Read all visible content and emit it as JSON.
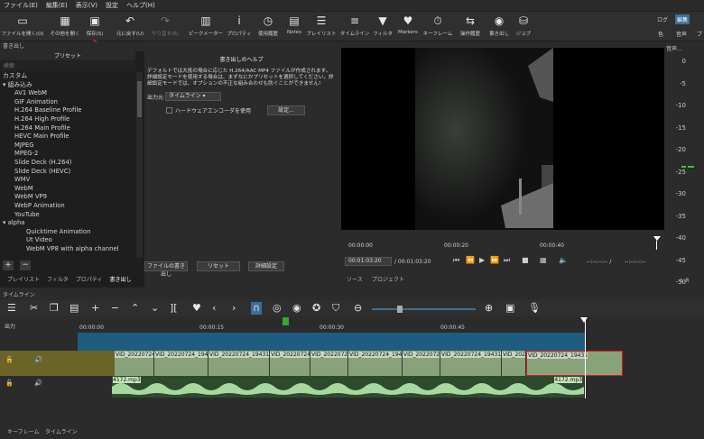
{
  "menu": [
    "ファイル(E)",
    "編集(E)",
    "表示(V)",
    "設定",
    "ヘルプ(H)"
  ],
  "toolbar": {
    "items": [
      {
        "label": "ファイルを開く(O)",
        "icon": "folder-icon"
      },
      {
        "label": "その他を開く",
        "icon": "file-open-icon"
      },
      {
        "label": "保存(S)",
        "icon": "save-icon"
      },
      {
        "label": "元に戻す(U)",
        "icon": "undo-icon"
      },
      {
        "label": "やり直す(R)",
        "icon": "redo-icon"
      },
      {
        "label": "ピークメーター",
        "icon": "peak-meter-icon"
      },
      {
        "label": "プロパティ",
        "icon": "info-icon"
      },
      {
        "label": "使用履歴",
        "icon": "history-icon"
      },
      {
        "label": "Notes",
        "icon": "notes-icon"
      },
      {
        "label": "プレイリスト",
        "icon": "playlist-icon"
      },
      {
        "label": "タイムライン",
        "icon": "timeline-icon"
      },
      {
        "label": "フィルタ",
        "icon": "filter-icon"
      },
      {
        "label": "Markers",
        "icon": "marker-icon"
      },
      {
        "label": "キーフレーム",
        "icon": "keyframe-icon"
      },
      {
        "label": "操作履歴",
        "icon": "job-history-icon"
      },
      {
        "label": "書き出し",
        "icon": "export-icon"
      },
      {
        "label": "ジョブ",
        "icon": "jobs-icon"
      }
    ],
    "right": {
      "log": "ログ",
      "edit": "編集",
      "color": "色",
      "audio": "音声",
      "extra": "プ"
    }
  },
  "export": {
    "panel_title": "書き出し",
    "preset_header": "プリセット",
    "filter_placeholder": "検索",
    "presets": [
      {
        "label": "カスタム",
        "indent": 1
      },
      {
        "label": "▾ 組み込み",
        "indent": 1
      },
      {
        "label": "AV1 WebM",
        "indent": 2
      },
      {
        "label": "GIF Animation",
        "indent": 2
      },
      {
        "label": "H.264 Baseline Profile",
        "indent": 2
      },
      {
        "label": "H.264 High Profile",
        "indent": 2
      },
      {
        "label": "H.264 Main Profile",
        "indent": 2
      },
      {
        "label": "HEVC Main Profile",
        "indent": 2
      },
      {
        "label": "MJPEG",
        "indent": 2
      },
      {
        "label": "MPEG-2",
        "indent": 2
      },
      {
        "label": "Slide Deck (H.264)",
        "indent": 2
      },
      {
        "label": "Slide Deck (HEVC)",
        "indent": 2
      },
      {
        "label": "WMV",
        "indent": 2
      },
      {
        "label": "WebM",
        "indent": 2
      },
      {
        "label": "WebM VP9",
        "indent": 2
      },
      {
        "label": "WebP Animation",
        "indent": 2
      },
      {
        "label": "YouTube",
        "indent": 2
      },
      {
        "label": "▾ alpha",
        "indent": 1
      },
      {
        "label": "Quicktime Animation",
        "indent": 3
      },
      {
        "label": "Ut Video",
        "indent": 3
      },
      {
        "label": "WebM VP8 with alpha channel",
        "indent": 3
      }
    ],
    "add_btn": "+",
    "remove_btn": "−",
    "tabs": [
      "プレイリスト",
      "フィルタ",
      "プロパティ",
      "書き出し"
    ],
    "help_title": "書き出しのヘルプ",
    "help_text": "デフォルトでは大抵の場合に応じた H.264/AAC MP4 ファイルが作成されます。詳細設定モードを使用する場合は、まずなにかプリセットを選択してください。詳細設定モードでは、オプションの不正な組み合わせも防ぐことができません!",
    "output_label": "出力元",
    "output_value": "タイムライン",
    "hw_encoder": "ハードウェアエンコーダを使用",
    "config_btn": "設定...",
    "export_file_btn": "ファイルの書き出し",
    "reset_btn": "リセット",
    "advanced_btn": "詳細設定"
  },
  "viewer": {
    "ruler_labels": [
      "00:00:00",
      "00:00:20",
      "00:00:40"
    ],
    "timecode": "00:01:03:20",
    "duration": "/ 00:01:03:20",
    "in_out": "--:--:--:-- /",
    "out": "--:--:--:--",
    "tabs": [
      "ソース",
      "プロジェクト"
    ]
  },
  "meter": {
    "title": "音声…",
    "labels": [
      "0",
      "-5",
      "-10",
      "-15",
      "-20",
      "-25",
      "-30",
      "-35",
      "-40",
      "-45",
      "-50"
    ],
    "lr": "L R"
  },
  "timeline": {
    "title": "タイムライン",
    "output_label": "出力",
    "ruler": [
      "00:00:00",
      "00:00:15",
      "00:00:30",
      "00:00:45"
    ],
    "clips": [
      "VID_20220724",
      "VID_20220724_194",
      "VID_20220724_19431",
      "VID_20220724",
      "VID_2022072",
      "VID_20220724_194",
      "VID_2022072",
      "VID_20220724_19431",
      "VID_2022",
      "VID_20220724_19431"
    ],
    "audio_name": "4172.mp3",
    "audio_name_end": "4172.mp3"
  },
  "status_tabs": [
    "キーフレーム",
    "タイムライン"
  ],
  "colors": {
    "accent": "#1f5c80",
    "video_track": "#6a6428",
    "meter_green": "#33cc33"
  }
}
